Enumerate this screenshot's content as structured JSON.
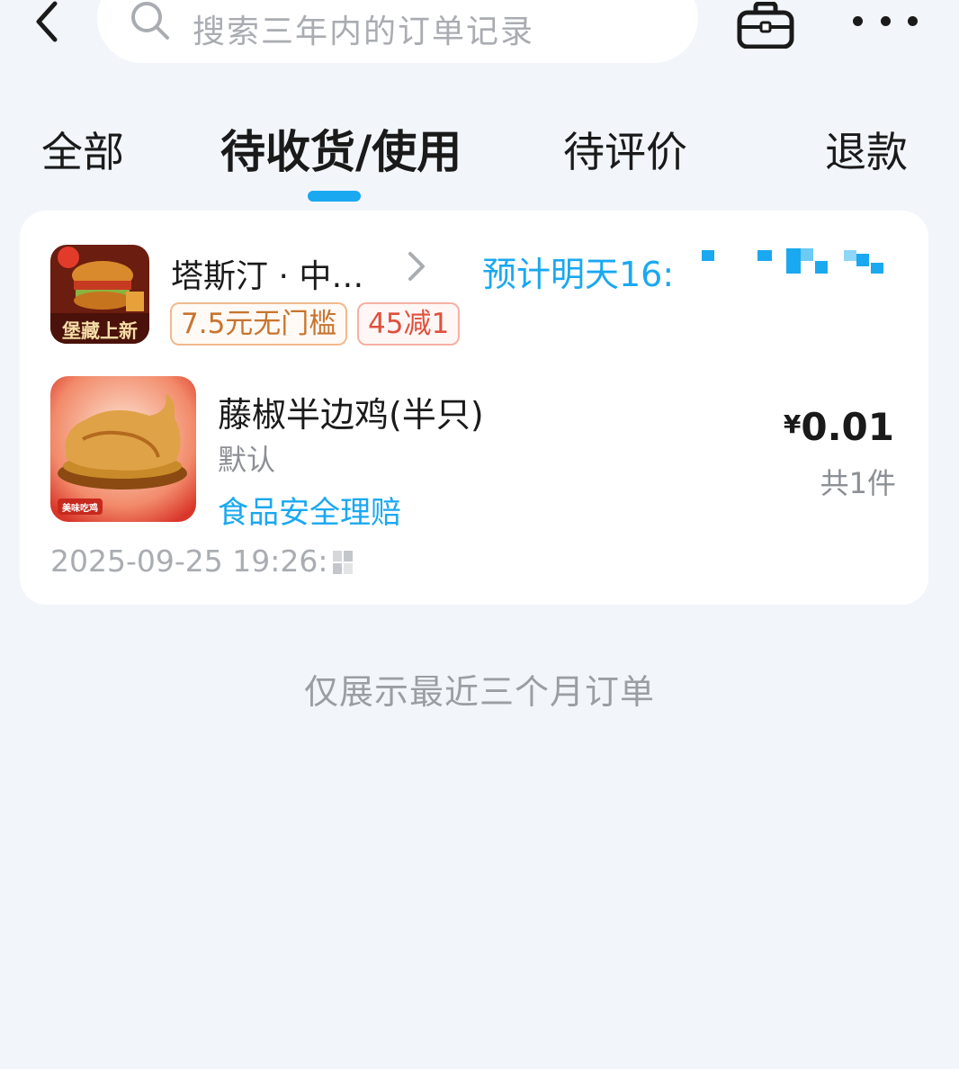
{
  "search": {
    "placeholder": "搜索三年内的订单记录"
  },
  "tabs": [
    {
      "label": "全部",
      "active": false
    },
    {
      "label": "待收货/使用",
      "active": true
    },
    {
      "label": "待评价",
      "active": false
    },
    {
      "label": "退款",
      "active": false
    }
  ],
  "order": {
    "store_name": "塔斯汀 · 中…",
    "store_logo_text": "堡藏上新",
    "eta": "预计明天16:",
    "coupons": [
      "7.5元无门槛",
      "45减1"
    ],
    "product": {
      "name": "藤椒半边鸡(半只)",
      "spec": "默认",
      "claim": "食品安全理赔",
      "image_badge": "美味吃鸡"
    },
    "price_currency": "¥",
    "price_value": "0.01",
    "quantity": "共1件",
    "time": "2025-09-25 19:26:3"
  },
  "footer_note": "仅展示最近三个月订单",
  "colors": {
    "accent": "#1aa8f0",
    "background": "#f2f6fa",
    "card": "#ffffff"
  },
  "icons": [
    "back-arrow-icon",
    "search-icon",
    "bag-icon",
    "more-icon",
    "chevron-right-icon"
  ]
}
